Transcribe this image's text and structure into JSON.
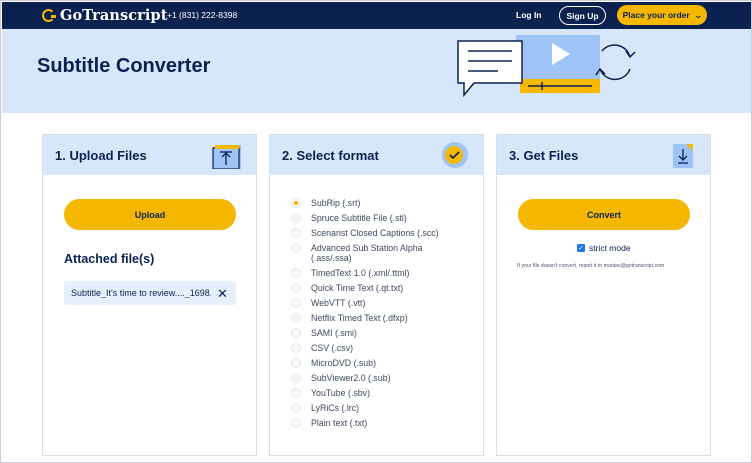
{
  "navbar": {
    "logo_text": "GoTranscript",
    "phone": "+1 (831) 222-8398",
    "login": "Log In",
    "signup": "Sign Up",
    "order": "Place your order",
    "order_icon": "chevron-down-icon"
  },
  "hero": {
    "title": "Subtitle Converter"
  },
  "colors": {
    "navy": "#0b2251",
    "accent": "#f5b700",
    "panel": "#d6e6fb"
  },
  "upload_card": {
    "title": "1. Upload Files",
    "icon": "upload-icon",
    "button": "Upload",
    "attached_title": "Attached file(s)",
    "file_name": "Subtitle_It's time to review...._1698...",
    "remove_icon": "close-icon"
  },
  "format_card": {
    "title": "2. Select format",
    "icon": "check-circle-icon",
    "selected": "SubRip (.srt)",
    "formats": [
      "SubRip (.srt)",
      "Spruce Subtitle File (.stl)",
      "Scenarist Closed Captions (.scc)",
      "Advanced Sub Station Alpha (.ass/.ssa)",
      "TimedText 1.0 (.xml/.ttml)",
      "Quick Time Text (.qt.txt)",
      "WebVTT (.vtt)",
      "Netflix Timed Text (.dfxp)",
      "SAMI (.smi)",
      "CSV (.csv)",
      "MicroDVD (.sub)",
      "SubViewer2.0 (.sub)",
      "YouTube (.sbv)",
      "LyRiCs (.lrc)",
      "Plain text (.txt)"
    ],
    "format_lines": [
      [
        "SubRip (.srt)"
      ],
      [
        "Spruce Subtitle File (.stl)"
      ],
      [
        "Scenarist Closed Captions (.scc)"
      ],
      [
        "Advanced Sub Station Alpha",
        "(.ass/.ssa)"
      ],
      [
        "TimedText 1.0 (.xml/.ttml)"
      ],
      [
        "Quick Time Text (.qt.txt)"
      ],
      [
        "WebVTT (.vtt)"
      ],
      [
        "Netflix Timed Text (.dfxp)"
      ],
      [
        "SAMI (.smi)"
      ],
      [
        "CSV (.csv)"
      ],
      [
        "MicroDVD (.sub)"
      ],
      [
        "SubViewer2.0 (.sub)"
      ],
      [
        "YouTube (.sbv)"
      ],
      [
        "LyRiCs (.lrc)"
      ],
      [
        "Plain text (.txt)"
      ]
    ]
  },
  "files_card": {
    "title": "3. Get Files",
    "icon": "download-icon",
    "button": "Convert",
    "strict_mode_label": "strict mode",
    "strict_mode_checked": true,
    "help_text": "If your file doesn't convert, report it to mantas@gotranscript.com"
  }
}
